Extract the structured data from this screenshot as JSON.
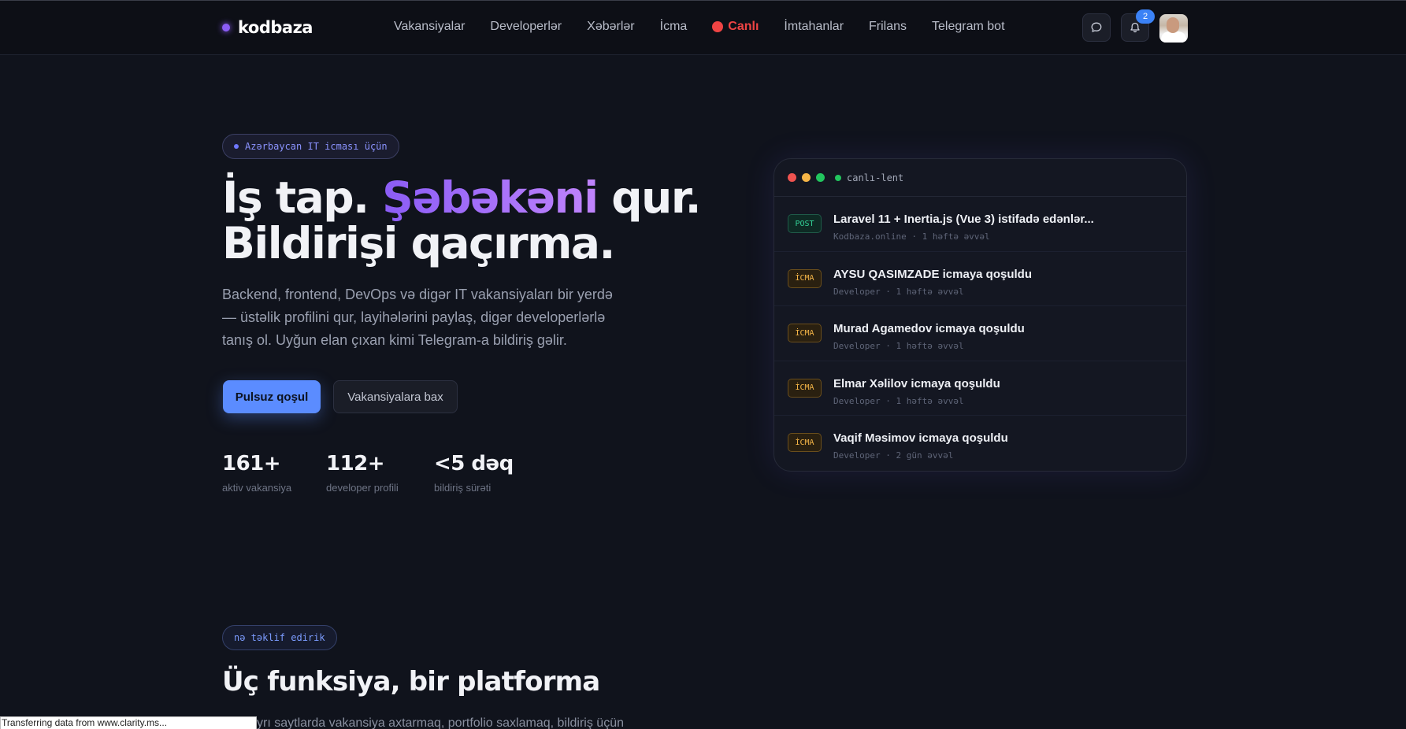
{
  "header": {
    "logo_text": "kodbaza",
    "nav": [
      {
        "label": "Vakansiyalar"
      },
      {
        "label": "Developerlər"
      },
      {
        "label": "Xəbərlər"
      },
      {
        "label": "İcma"
      },
      {
        "label": "Canlı",
        "live": true
      },
      {
        "label": "İmtahanlar"
      },
      {
        "label": "Frilans"
      },
      {
        "label": "Telegram bot"
      }
    ],
    "notification_count": "2",
    "icons": {
      "chat": "chat-bubble-icon",
      "bell": "bell-icon"
    }
  },
  "hero": {
    "pill": "Azərbaycan IT icması üçün",
    "title_part1": "İş tap. ",
    "title_highlight": "Şəbəkəni",
    "title_part2": " qur.",
    "title_line2": "Bildirişi qaçırma.",
    "description": "Backend, frontend, DevOps və digər IT vakansiyaları bir yerdə — üstəlik profilini qur, layihələrini paylaş, digər developerlərlə tanış ol. Uyğun elan çıxan kimi Telegram-a bildiriş gəlir.",
    "primary_button": "Pulsuz qoşul",
    "secondary_button": "Vakansiyalara bax",
    "stats": [
      {
        "value": "161+",
        "label": "aktiv vakansiya"
      },
      {
        "value": "112+",
        "label": "developer profili"
      },
      {
        "value": "<5 dəq",
        "label": "bildiriş sürəti"
      }
    ]
  },
  "feed": {
    "title": "canlı-lent",
    "items": [
      {
        "tag": "POST",
        "title": "Laravel 11 + Inertia.js (Vue 3) istifadə edənlər...",
        "meta": "Kodbaza.online · 1 həftə əvvəl"
      },
      {
        "tag": "İCMA",
        "title": "AYSU QASIMZADE icmaya qoşuldu",
        "meta": "Developer · 1 həftə əvvəl"
      },
      {
        "tag": "İCMA",
        "title": "Murad Agamedov icmaya qoşuldu",
        "meta": "Developer · 1 həftə əvvəl"
      },
      {
        "tag": "İCMA",
        "title": "Elmar Xəlilov icmaya qoşuldu",
        "meta": "Developer · 1 həftə əvvəl"
      },
      {
        "tag": "İCMA",
        "title": "Vaqif Məsimov icmaya qoşuldu",
        "meta": "Developer · 2 gün əvvəl"
      }
    ]
  },
  "features": {
    "pill": "nə təklif edirik",
    "title": "Üç funksiya, bir platforma",
    "description_partial": "yrı saytlarda vakansiya axtarmaq, portfolio saxlamaq, bildiriş üçün"
  },
  "status_bar": "Transferring data from www.clarity.ms..."
}
